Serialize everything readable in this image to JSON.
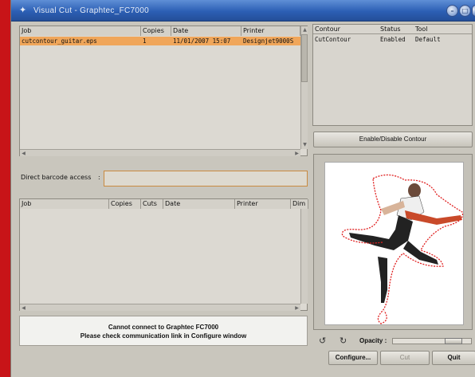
{
  "window": {
    "title": "Visual Cut - Graphtec_FC7000",
    "controls": [
      "minimize",
      "maximize",
      "close"
    ]
  },
  "job_list": {
    "columns": [
      "Job",
      "Copies",
      "Date",
      "Printer"
    ],
    "rows": [
      {
        "job": "cutcontour_guitar.eps",
        "copies": "1",
        "date": "11/01/2007 15:07",
        "printer": "Designjet9000S"
      }
    ]
  },
  "barcode": {
    "label": "Direct barcode access",
    "separator": ":",
    "value": ""
  },
  "cut_list": {
    "columns": [
      "Job",
      "Copies",
      "Cuts",
      "Date",
      "Printer",
      "Dim"
    ]
  },
  "status_message": {
    "line1": "Cannot connect to Graphtec FC7000",
    "line2": "Please check communication link in Configure window"
  },
  "contour_list": {
    "columns": [
      "Contour",
      "Status",
      "Tool"
    ],
    "rows": [
      {
        "contour": "CutContour",
        "status": "Enabled",
        "tool": "Default"
      }
    ]
  },
  "enable_disable_button": "Enable/Disable Contour",
  "opacity": {
    "label": "Opacity :",
    "value": 0.85
  },
  "buttons": {
    "configure": "Configure...",
    "cut": "Cut",
    "quit": "Quit"
  },
  "colors": {
    "selection": "#f0a65a",
    "contour_line": "#e02020",
    "titlebar": "#2c5fb4",
    "desktop": "#c81418"
  },
  "icons": [
    "rotate-left-icon",
    "rotate-right-icon",
    "window-menu-icon"
  ]
}
